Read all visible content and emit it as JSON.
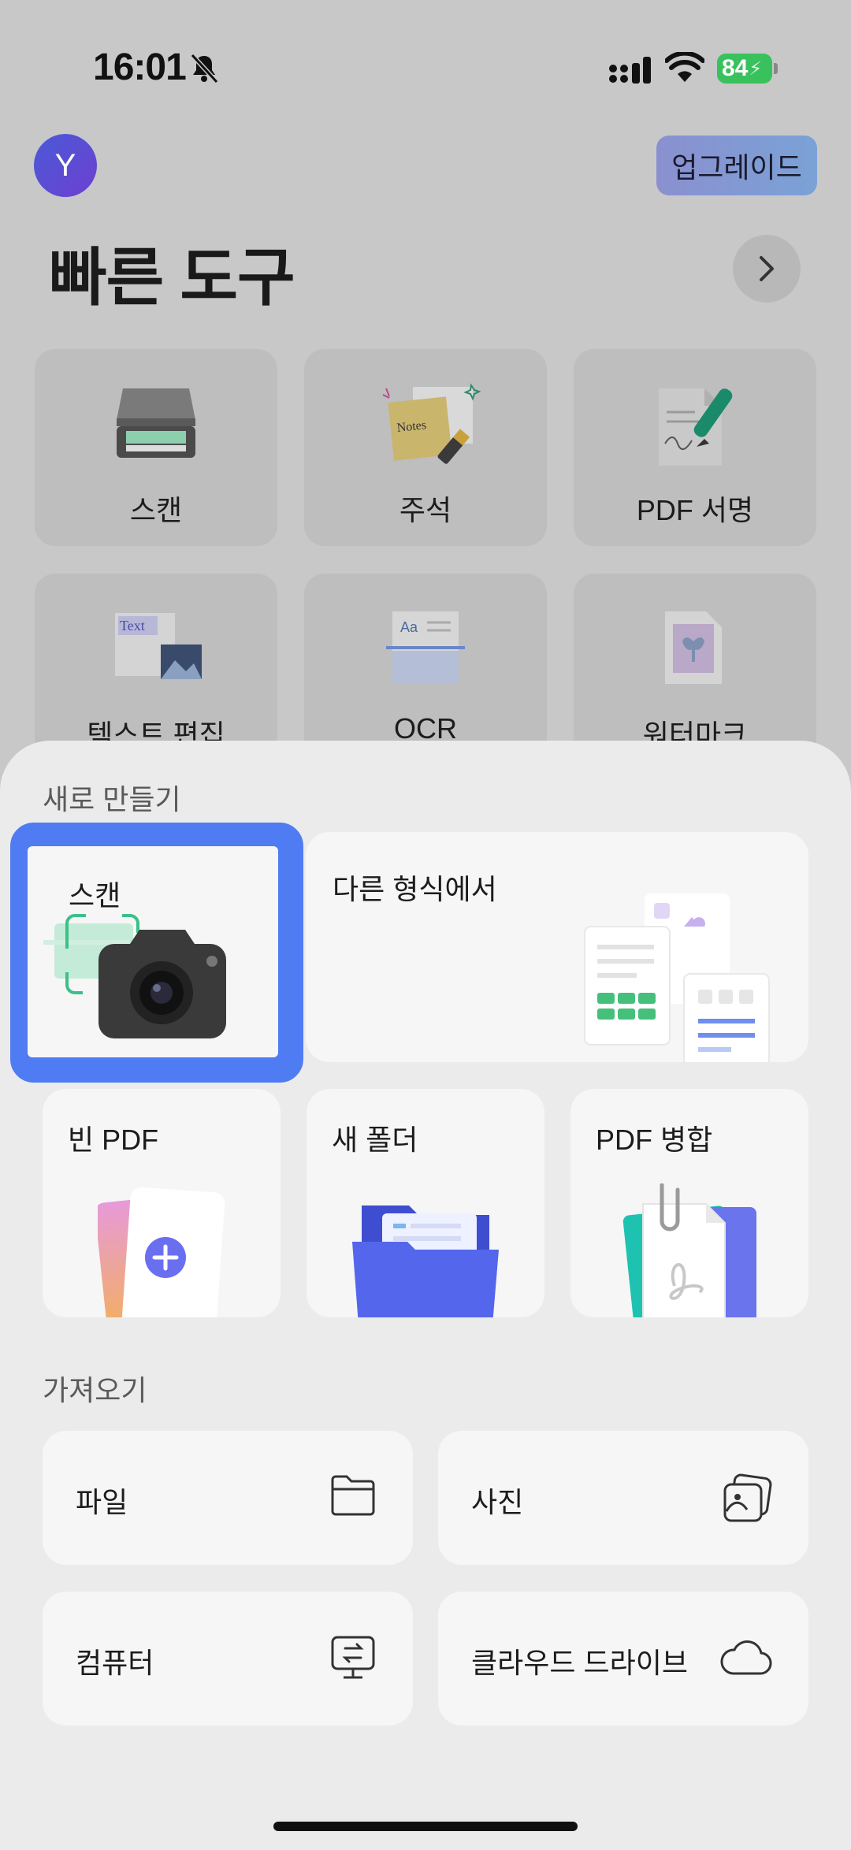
{
  "status_bar": {
    "time": "16:01",
    "battery": "84"
  },
  "header": {
    "avatar_initial": "Y",
    "upgrade_label": "업그레이드"
  },
  "quick_tools": {
    "title": "빠른 도구",
    "items": [
      {
        "label": "스캔"
      },
      {
        "label": "주석"
      },
      {
        "label": "PDF 서명"
      },
      {
        "label": "텍스트 편집"
      },
      {
        "label": "OCR"
      },
      {
        "label": "워터마크"
      }
    ]
  },
  "create_new": {
    "title": "새로 만들기",
    "scan": "스캔",
    "from_other_format": "다른 형식에서",
    "blank_pdf": "빈 PDF",
    "new_folder": "새 폴더",
    "merge_pdf": "PDF 병합"
  },
  "import": {
    "title": "가져오기",
    "file": "파일",
    "photo": "사진",
    "computer": "컴퓨터",
    "cloud_drive": "클라우드 드라이브"
  },
  "colors": {
    "accent": "#4f7cf2",
    "battery": "#38c15c",
    "folder": "#4c5ee8"
  },
  "icons": [
    "bell-slash-icon",
    "signal-icon",
    "wifi-icon",
    "chevron-right-icon",
    "folder-icon",
    "photo-icon",
    "computer-icon",
    "cloud-icon",
    "camera-icon",
    "plus-icon",
    "paperclip-icon"
  ]
}
